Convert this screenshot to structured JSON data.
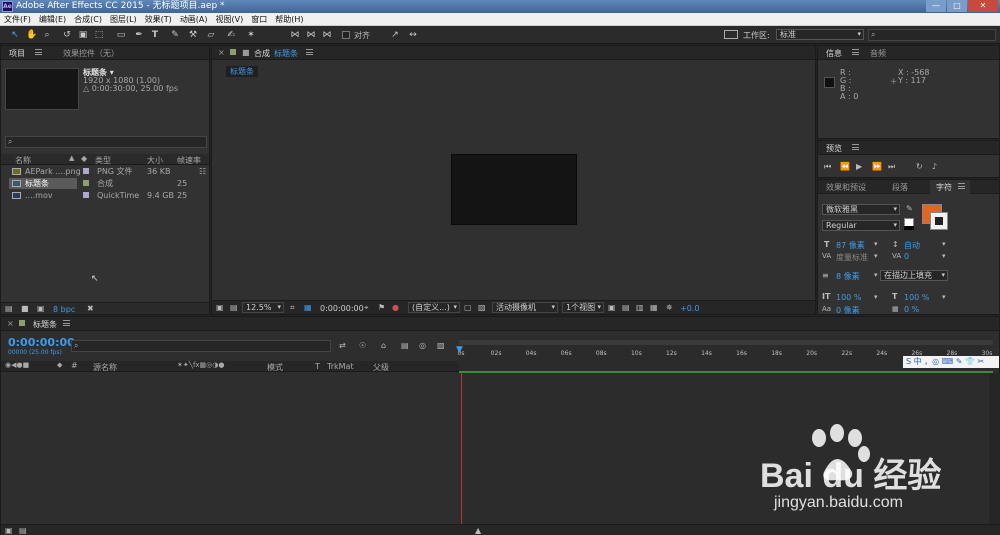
{
  "window": {
    "title": "Adobe After Effects CC 2015 - 无标题项目.aep *",
    "app_badge": "Ae",
    "minimize": "—",
    "maximize": "□",
    "close": "✕"
  },
  "menu": [
    "文件(F)",
    "编辑(E)",
    "合成(C)",
    "图层(L)",
    "效果(T)",
    "动画(A)",
    "视图(V)",
    "窗口",
    "帮助(H)"
  ],
  "toolbar": {
    "snap_label": "对齐",
    "workspace_label": "工作区:",
    "workspace_value": "标准"
  },
  "project": {
    "tab_project": "项目",
    "tab_effects": "效果控件（无）",
    "comp_name": "标题条 ▾",
    "comp_size": "1920 x 1080 (1.00)",
    "comp_duration": "△ 0:00:30:00, 25.00 fps",
    "columns": {
      "name": "名称",
      "type": "类型",
      "size": "大小",
      "fps": "帧速率"
    },
    "items": [
      {
        "name": "AEPark ....png",
        "type": "PNG 文件",
        "size": "36 KB",
        "fps": ""
      },
      {
        "name": "标题条",
        "type": "合成",
        "size": "",
        "fps": "25"
      },
      {
        "name": "....mov",
        "type": "QuickTime",
        "size": "9.4 GB",
        "fps": "25"
      }
    ],
    "bpc": "8 bpc"
  },
  "composition": {
    "tab_label": "合成",
    "comp_name": "标题条",
    "breadcrumb": "标题条",
    "zoom": "12.5%",
    "timecode": "0:00:00:00",
    "resolution": "(自定义...)",
    "camera": "活动摄像机",
    "views": "1个视图",
    "exposure": "+0.0",
    "frame_color": "#141414"
  },
  "info": {
    "tab_info": "信息",
    "tab_audio": "音频",
    "r": "R :",
    "g": "G :",
    "b": "B :",
    "a": "A : 0",
    "x": "X : -568",
    "y": "Y : 117"
  },
  "preview": {
    "tab": "预览"
  },
  "character": {
    "tab_effects_presets": "效果和预设",
    "tab_paragraph": "段落",
    "tab_character": "字符",
    "font": "微软雅黑",
    "style": "Regular",
    "size": "87 像素",
    "leading": "自动",
    "kerning": "度量标准",
    "tracking": "0",
    "stroke_width": "8 像素",
    "stroke_mode": "在描边上填充",
    "vscale": "100 %",
    "hscale": "100 %",
    "baseline": "0 像素",
    "tsume": "0 %",
    "fill_color": "#e8641e"
  },
  "timeline": {
    "tab": "标题条",
    "timecode": "0:00:00:00",
    "fps_sub": "00000 (25.00 fps)",
    "layer_col_name": "源名称",
    "col_mode": "模式",
    "col_t": "T",
    "col_trkmat": "TrkMat",
    "col_parent": "父级",
    "ticks": [
      "0s",
      "02s",
      "04s",
      "06s",
      "08s",
      "10s",
      "12s",
      "14s",
      "16s",
      "18s",
      "20s",
      "22s",
      "24s",
      "26s",
      "28s",
      "30s"
    ],
    "ime": "S 中 ，◎ ⌨ ✎ 👕 ✂"
  },
  "watermark": {
    "logo": "Bai du 经验",
    "url": "jingyan.baidu.com"
  }
}
